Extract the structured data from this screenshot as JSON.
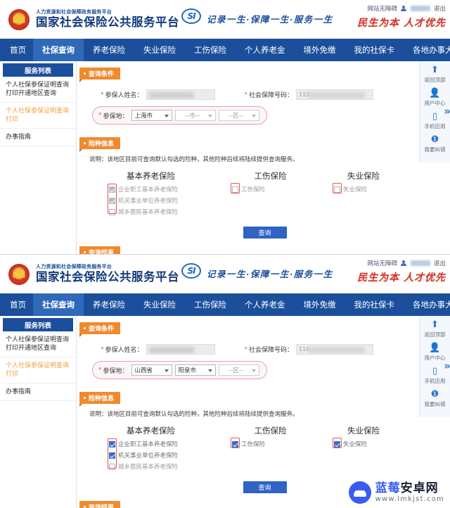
{
  "header": {
    "sub_title": "人力资源和社会保障政务服务平台",
    "main_title": "国家社会保险公共服务平台",
    "si_logo_text": "SI",
    "slogan": "记录一生·保障一生·服务一生",
    "accessibility_label": "网站无障碍",
    "logout_label": "退出",
    "calligraphy": "民生为本 人才优先",
    "emblem_icon": "national-emblem-icon",
    "user_icon": "user-icon"
  },
  "nav": {
    "items": [
      {
        "label": "首页",
        "active": false
      },
      {
        "label": "社保查询",
        "active": true
      },
      {
        "label": "养老保险",
        "active": false
      },
      {
        "label": "失业保险",
        "active": false
      },
      {
        "label": "工伤保险",
        "active": false
      },
      {
        "label": "个人养老金",
        "active": false
      },
      {
        "label": "境外免缴",
        "active": false
      },
      {
        "label": "我的社保卡",
        "active": false
      },
      {
        "label": "各地办事大厅",
        "active": false
      }
    ]
  },
  "sidebar": {
    "title": "服务列表",
    "items": [
      {
        "label": "个人社保参保证明查询打印开通地区查询",
        "active": false
      },
      {
        "label": "个人社保参保证明查询打印",
        "active": true
      },
      {
        "label": "办事指南",
        "active": false
      }
    ]
  },
  "rail": {
    "items": [
      {
        "icon": "back-to-top-icon",
        "glyph": "⬆",
        "label": "返回顶部"
      },
      {
        "icon": "user-center-icon",
        "glyph": "👤",
        "label": "用户中心"
      },
      {
        "icon": "mobile-app-icon",
        "glyph": "▯",
        "label": "手机应用"
      },
      {
        "icon": "report-error-icon",
        "glyph": "❶",
        "label": "我要纠错"
      }
    ],
    "collapse_glyph": "»"
  },
  "panels": [
    {
      "query_tab": "查询条件",
      "result_tab": "查询结果",
      "insurance_tab": "险种信息",
      "name_label": "参保人姓名：",
      "name_value": "",
      "id_label": "社会保障号码：",
      "id_prefix": "110",
      "region_label": "参保地：",
      "province": "上海市",
      "city": "--市--",
      "district": "--区--",
      "city_empty": true,
      "district_empty": true,
      "note": "说明：该地区目前可查询默认勾选的险种，其他险种后续将陆续提供查询服务。",
      "columns": [
        {
          "title": "基本养老保险",
          "items": [
            {
              "label": "企业职工基本养老保险",
              "checked": true,
              "dim": true
            },
            {
              "label": "机关事业单位养老保险",
              "checked": true,
              "dim": true
            },
            {
              "label": "城乡居民基本养老保险",
              "checked": false,
              "dim": true
            }
          ]
        },
        {
          "title": "工伤保险",
          "items": [
            {
              "label": "工伤保险",
              "checked": false,
              "dim": true
            }
          ]
        },
        {
          "title": "失业保险",
          "items": [
            {
              "label": "失业保险",
              "checked": false,
              "dim": true
            }
          ]
        }
      ],
      "query_button": "查询"
    },
    {
      "query_tab": "查询条件",
      "result_tab": "查询结果",
      "insurance_tab": "险种信息",
      "name_label": "参保人姓名：",
      "name_value": "",
      "id_label": "社会保障号码：",
      "id_prefix": "110",
      "region_label": "参保地：",
      "province": "山西省",
      "city": "阳泉市",
      "district": "--区--",
      "city_empty": false,
      "district_empty": true,
      "note": "说明：该地区目前可查询默认勾选的险种，其他险种后续将陆续提供查询服务。",
      "columns": [
        {
          "title": "基本养老保险",
          "items": [
            {
              "label": "企业职工基本养老保险",
              "checked": true,
              "dim": false
            },
            {
              "label": "机关事业单位养老保险",
              "checked": true,
              "dim": false
            },
            {
              "label": "城乡居民基本养老保险",
              "checked": false,
              "dim": true
            }
          ]
        },
        {
          "title": "工伤保险",
          "items": [
            {
              "label": "工伤保险",
              "checked": true,
              "dim": false
            }
          ]
        },
        {
          "title": "失业保险",
          "items": [
            {
              "label": "失业保险",
              "checked": true,
              "dim": false
            }
          ]
        }
      ],
      "query_button": "查询"
    }
  ],
  "watermark": {
    "text_blue": "蓝莓",
    "text_dark": "安卓网",
    "url": "www.lmkjst.com",
    "icon": "android-robot-icon"
  },
  "colors": {
    "nav_blue": "#1b4f9c",
    "accent_orange": "#f08a2e",
    "button_blue": "#2f63c4",
    "highlight_red": "#e2574c"
  }
}
